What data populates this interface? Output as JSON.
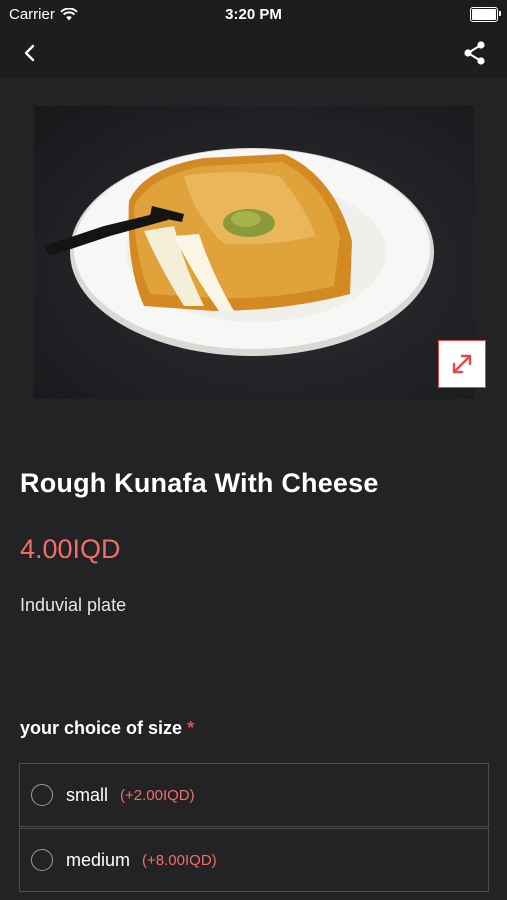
{
  "status_bar": {
    "carrier": "Carrier",
    "time": "3:20 PM"
  },
  "nav": {
    "back_icon": "chevron-left-icon",
    "share_icon": "share-icon"
  },
  "product": {
    "image_alt": "Rough Kunafa With Cheese",
    "name": "Rough Kunafa With Cheese",
    "price": "4.00IQD",
    "description": "Induvial plate"
  },
  "size_section": {
    "title": "your choice of size",
    "required_mark": "*",
    "options": [
      {
        "name": "small",
        "extra": "(+2.00IQD)",
        "selected": false
      },
      {
        "name": "medium",
        "extra": "(+8.00IQD)",
        "selected": false
      }
    ]
  },
  "colors": {
    "background": "#232326",
    "bar": "#1d1d20",
    "accent": "#ef6f68",
    "required": "#e24a4a"
  }
}
